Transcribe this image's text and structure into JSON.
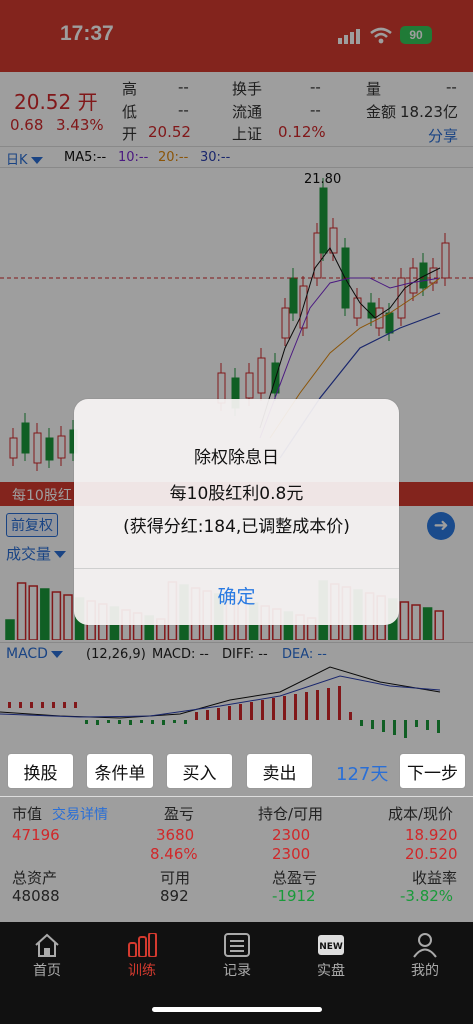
{
  "status": {
    "time": "17:37",
    "battery": "90"
  },
  "quote": {
    "price": "20.52 开",
    "change": "0.68",
    "change_pct": "3.43%",
    "high_label": "高",
    "high_val": "--",
    "low_label": "低",
    "low_val": "--",
    "open_label": "开",
    "open_val": "20.52",
    "turnover_label": "换手",
    "turnover_val": "--",
    "float_label": "流通",
    "float_val": "--",
    "index_label": "上证",
    "index_val": "0.12%",
    "volume_label": "量",
    "volume_val": "--",
    "amount_label": "金额",
    "amount_val": "18.23亿",
    "share": "分享"
  },
  "kline": {
    "period": "日K",
    "ma5": "MA5:--",
    "ma10": "10:--",
    "ma20": "20:--",
    "ma30": "30:--",
    "high_mark": "21.80",
    "dividend_banner": "每10股红",
    "adjust": "前复权",
    "volume_title": "成交量",
    "macd_title": "MACD",
    "macd_params": "(12,26,9)",
    "macd_val": "MACD: --",
    "diff_val": "DIFF: --",
    "dea_val": "DEA: --"
  },
  "dialog": {
    "title": "除权除息日",
    "line1": "每10股红利0.8元",
    "line2": "(获得分红:184,已调整成本价)",
    "ok": "确定"
  },
  "actions": {
    "swap": "换股",
    "condition": "条件单",
    "buy": "买入",
    "sell": "卖出",
    "days": "127天",
    "next": "下一步"
  },
  "account": {
    "mv_label": "市值",
    "trade_detail": "交易详情",
    "pl_label": "盈亏",
    "pos_label": "持仓/可用",
    "cost_label": "成本/现价",
    "mv": "47196",
    "pl": "3680",
    "pl_pct": "8.46%",
    "pos": "2300",
    "avail_pos": "2300",
    "cost": "18.920",
    "price": "20.520",
    "assets_label": "总资产",
    "avail_label": "可用",
    "total_pl_label": "总盈亏",
    "ret_label": "收益率",
    "assets": "48088",
    "avail": "892",
    "total_pl": "-1912",
    "ret": "-3.82%"
  },
  "tabs": {
    "home": "首页",
    "train": "训练",
    "record": "记录",
    "live": "实盘",
    "mine": "我的"
  },
  "colors": {
    "up": "#d0282a",
    "down": "#1a9a3a",
    "accent": "#2a6fd6",
    "header": "#d33a2f"
  }
}
